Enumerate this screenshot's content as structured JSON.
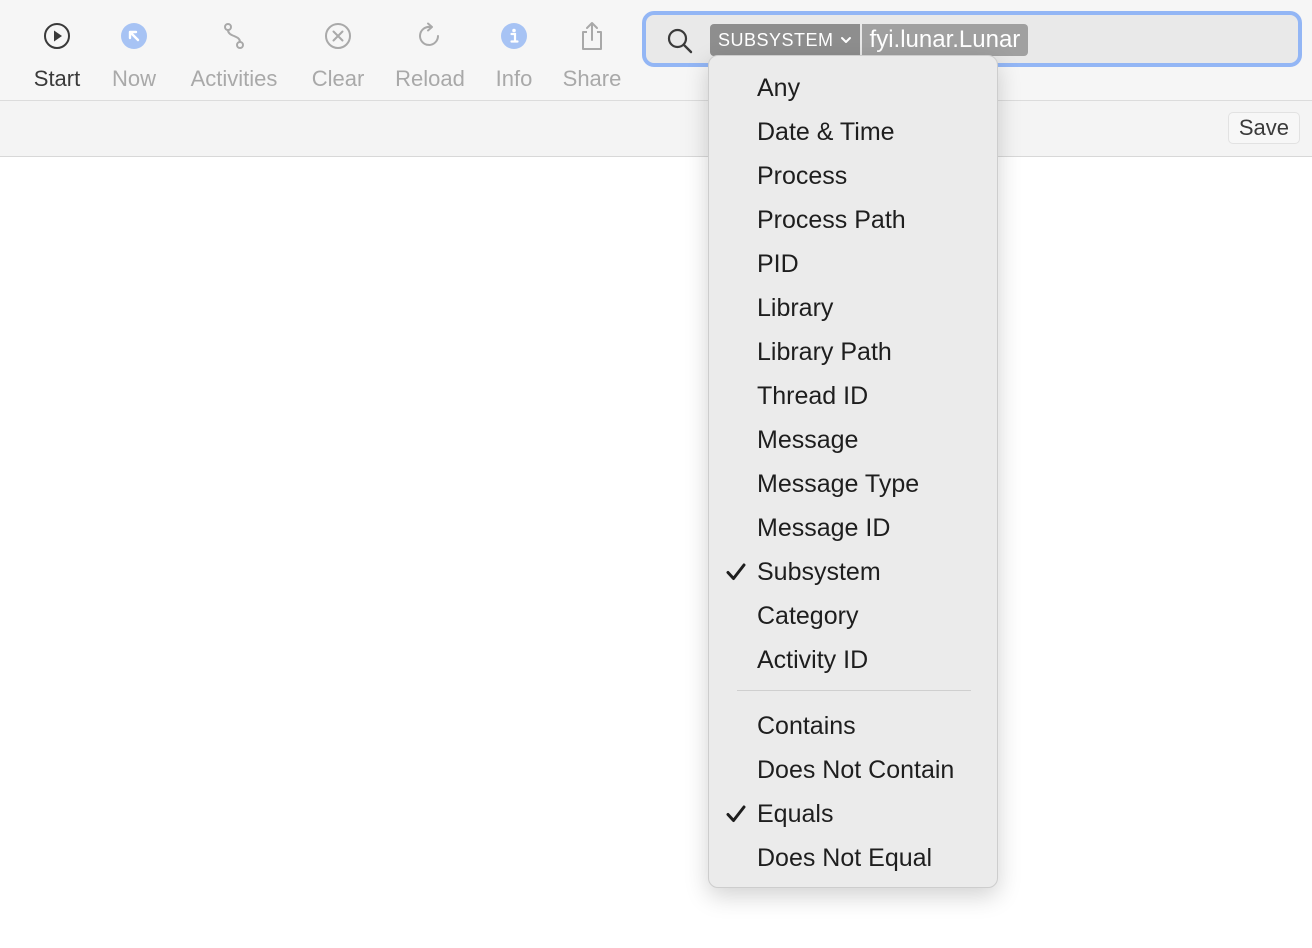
{
  "toolbar": {
    "buttons": [
      {
        "label": "Start",
        "icon": "play-icon",
        "enabled": true
      },
      {
        "label": "Now",
        "icon": "now-arrow-icon",
        "enabled": false
      },
      {
        "label": "Activities",
        "icon": "activities-icon",
        "enabled": false
      },
      {
        "label": "Clear",
        "icon": "clear-icon",
        "enabled": false
      },
      {
        "label": "Reload",
        "icon": "reload-icon",
        "enabled": false
      },
      {
        "label": "Info",
        "icon": "info-icon",
        "enabled": false
      },
      {
        "label": "Share",
        "icon": "share-icon",
        "enabled": false
      }
    ]
  },
  "search": {
    "token_key": "SUBSYSTEM",
    "token_value": "fyi.lunar.Lunar"
  },
  "subbar": {
    "save_label": "Save"
  },
  "menu": {
    "fields": [
      {
        "label": "Any",
        "checked": false
      },
      {
        "label": "Date & Time",
        "checked": false
      },
      {
        "label": "Process",
        "checked": false
      },
      {
        "label": "Process Path",
        "checked": false
      },
      {
        "label": "PID",
        "checked": false
      },
      {
        "label": "Library",
        "checked": false
      },
      {
        "label": "Library Path",
        "checked": false
      },
      {
        "label": "Thread ID",
        "checked": false
      },
      {
        "label": "Message",
        "checked": false
      },
      {
        "label": "Message Type",
        "checked": false
      },
      {
        "label": "Message ID",
        "checked": false
      },
      {
        "label": "Subsystem",
        "checked": true
      },
      {
        "label": "Category",
        "checked": false
      },
      {
        "label": "Activity ID",
        "checked": false
      }
    ],
    "operators": [
      {
        "label": "Contains",
        "checked": false
      },
      {
        "label": "Does Not Contain",
        "checked": false
      },
      {
        "label": "Equals",
        "checked": true
      },
      {
        "label": "Does Not Equal",
        "checked": false
      }
    ]
  },
  "colors": {
    "accent": "#93b6f5",
    "now_icon": "#a7c3f4",
    "info_icon": "#a7c3f4",
    "token_key_bg": "#8e8e8e",
    "token_value_bg": "#a0a0a0"
  }
}
